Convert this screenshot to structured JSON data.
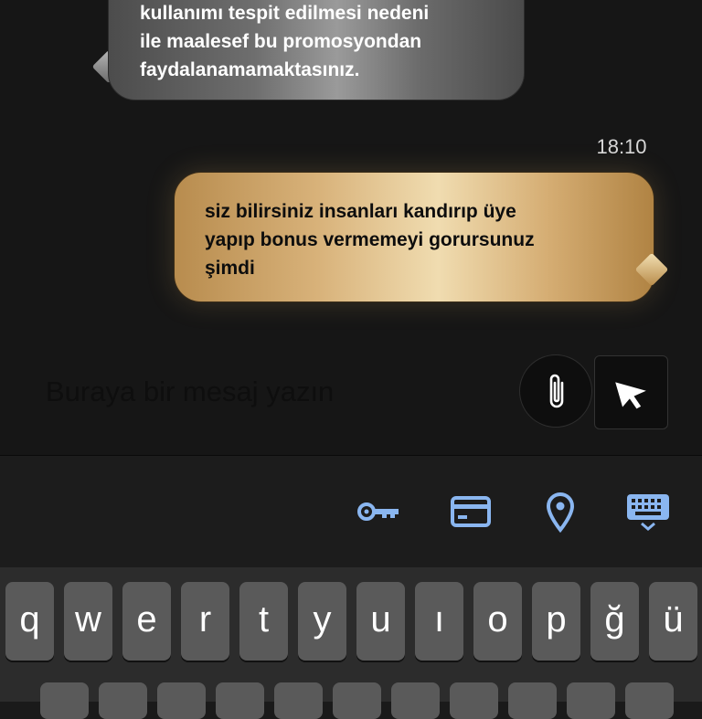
{
  "messages": {
    "incoming": {
      "lines": [
        "kullanımı tespit edilmesi nedeni",
        "ile maalesef bu promosyondan",
        "faydalanamamaktasınız."
      ]
    },
    "timestamp": "18:10",
    "outgoing": {
      "lines": [
        "siz bilirsiniz insanları kandırıp üye",
        "yapıp bonus vermemeyi gorursunuz",
        "şimdi"
      ]
    }
  },
  "compose": {
    "placeholder": "Buraya bir mesaj yazın"
  },
  "toolbar": {
    "icons": [
      "key-icon",
      "card-icon",
      "location-pin-icon",
      "keyboard-icon"
    ],
    "icon_color": "#8ab6f0"
  },
  "keyboard": {
    "row1": [
      "q",
      "w",
      "e",
      "r",
      "t",
      "y",
      "u",
      "ı",
      "o",
      "p",
      "ğ",
      "ü"
    ]
  },
  "colors": {
    "incoming_bubble": "#7a7a7a",
    "outgoing_bubble": "#e3c28c",
    "background": "#161616"
  }
}
